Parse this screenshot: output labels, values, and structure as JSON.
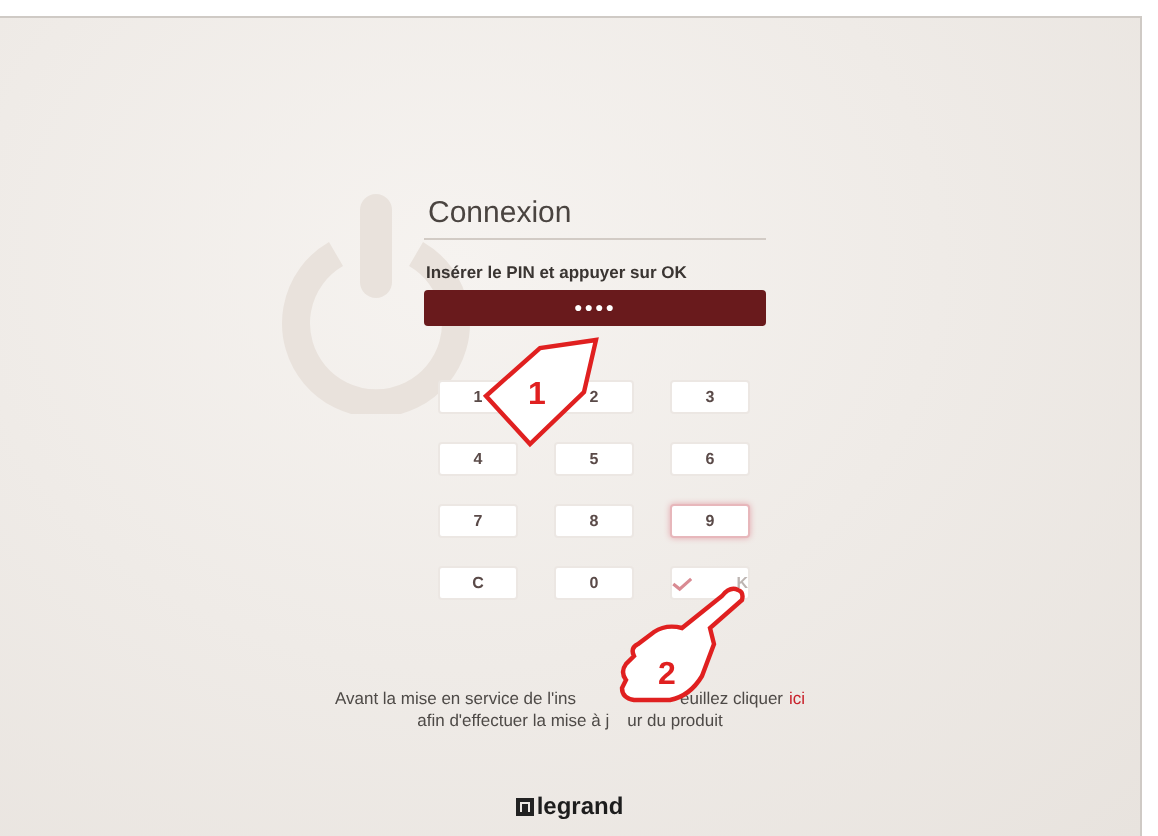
{
  "login": {
    "title": "Connexion",
    "instruction": "Insérer le PIN et appuyer sur OK",
    "pin_value": "●●●●"
  },
  "keypad": [
    {
      "label": "1",
      "kind": "digit",
      "selected": false
    },
    {
      "label": "2",
      "kind": "digit",
      "selected": false
    },
    {
      "label": "3",
      "kind": "digit",
      "selected": false
    },
    {
      "label": "4",
      "kind": "digit",
      "selected": false
    },
    {
      "label": "5",
      "kind": "digit",
      "selected": false
    },
    {
      "label": "6",
      "kind": "digit",
      "selected": false
    },
    {
      "label": "7",
      "kind": "digit",
      "selected": false
    },
    {
      "label": "8",
      "kind": "digit",
      "selected": false
    },
    {
      "label": "9",
      "kind": "digit",
      "selected": true
    },
    {
      "label": "C",
      "kind": "clear",
      "selected": false
    },
    {
      "label": "0",
      "kind": "digit",
      "selected": false
    },
    {
      "label": "K",
      "kind": "ok",
      "selected": false
    }
  ],
  "notice": {
    "line_1": [
      "Avant la mise en service de l'ins",
      "euillez cliquer"
    ],
    "link": "ici",
    "line_2": [
      "afin d'effectuer la mise à j",
      "ur du produit"
    ]
  },
  "callouts": [
    {
      "number": "1",
      "kind": "tag"
    },
    {
      "number": "2",
      "kind": "hand"
    }
  ],
  "footer": {
    "logo": "legrand"
  }
}
